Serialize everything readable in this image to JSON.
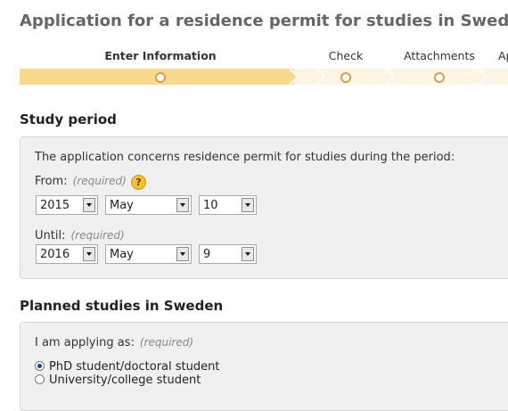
{
  "page": {
    "title": "Application for a residence permit for studies in Sweden"
  },
  "progress": {
    "steps": [
      {
        "label": "Enter Information",
        "state": "active"
      },
      {
        "label": "Check",
        "state": "upcoming"
      },
      {
        "label": "Attachments",
        "state": "upcoming"
      },
      {
        "label": "Ap",
        "state": "upcoming"
      }
    ],
    "colors": {
      "done": "#f8d98d",
      "pending": "#fff5e4",
      "marker": "#d1a055"
    }
  },
  "study_period": {
    "heading": "Study period",
    "intro": "The application concerns residence permit for studies during the period:",
    "from": {
      "label": "From:",
      "required": "(required)",
      "help_icon": "question-icon",
      "help_text": "?",
      "year": "2015",
      "month": "May",
      "day": "10"
    },
    "until": {
      "label": "Until:",
      "required": "(required)",
      "year": "2016",
      "month": "May",
      "day": "9"
    }
  },
  "planned_studies": {
    "heading": "Planned studies in Sweden",
    "applying_as_label": "I am applying as:",
    "required": "(required)",
    "options": [
      {
        "label": "PhD student/doctoral student",
        "selected": true
      },
      {
        "label": "University/college student",
        "selected": false
      }
    ]
  }
}
